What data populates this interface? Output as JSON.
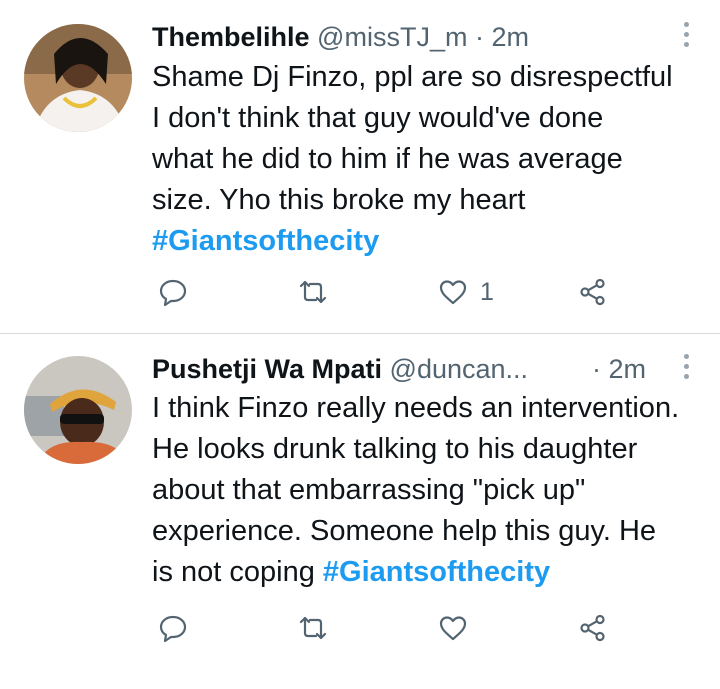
{
  "tweets": [
    {
      "name": "Thembelihle",
      "handle": "@missTJ_m",
      "separator": "·",
      "time": "2m",
      "text_lines": [
        "Shame Dj Finzo, ppl are so disrespectful",
        "I don't think that guy would've done",
        "what he did to him if he was average",
        "size. Yho this broke my heart"
      ],
      "hashtag": "#Giantsofthecity",
      "reply_count": "",
      "retweet_count": "",
      "like_count": "1"
    },
    {
      "name": "Pushetji Wa Mpati",
      "handle": "@duncan...",
      "separator": "·",
      "time": "2m",
      "text_lines": [
        "I think Finzo really needs an intervention.",
        "He looks drunk talking to his daughter",
        "about that embarrassing \"pick up\"",
        "experience. Someone help this guy. He"
      ],
      "last_line_prefix": "is not coping ",
      "hashtag": "#Giantsofthecity",
      "reply_count": "",
      "retweet_count": "",
      "like_count": ""
    }
  ],
  "icons": {
    "reply": "speech-bubble-icon",
    "retweet": "retweet-icon",
    "like": "heart-icon",
    "share": "share-icon",
    "more": "more-vertical-icon"
  },
  "colors": {
    "text": "#0f1419",
    "secondary": "#536471",
    "hashtag": "#1d9bf0",
    "divider": "#d6dbe0"
  }
}
